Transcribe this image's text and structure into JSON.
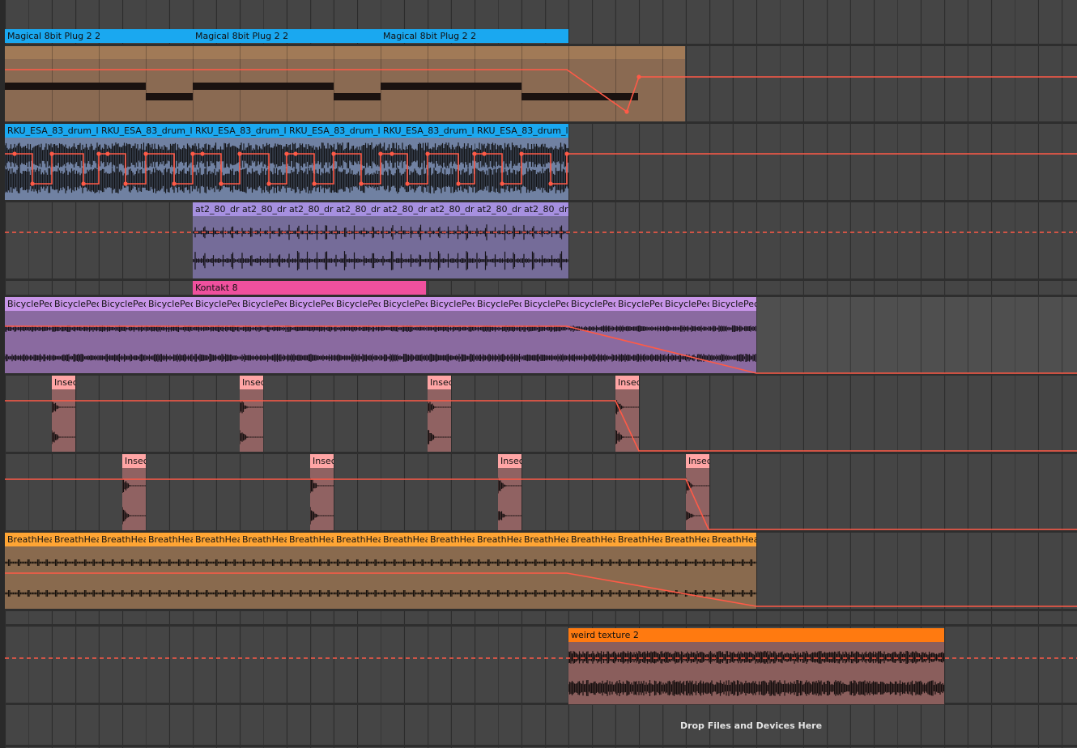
{
  "colors": {
    "background": "#454545",
    "automation": "#ff5a47",
    "clip_blue": "#1aa8f0",
    "clip_tan": "#8a6a52",
    "clip_lavender_header": "#a690e0",
    "clip_lavender_body": "#756c99",
    "clip_pink_header": "#f0509e",
    "clip_violet_header": "#c895e8",
    "clip_violet_body": "#8a6aa0",
    "clip_salmon_header": "#ffa5a5",
    "clip_salmon_body": "#906262",
    "clip_orange_header": "#ffa534",
    "clip_orange_body": "#896a4e",
    "clip_orange2_header": "#ff7a10",
    "clip_orange2_body": "#8a5e5c"
  },
  "tracks": [
    {
      "name": "magical-8bit-track",
      "clips": [
        "Magical 8bit Plug 2 2",
        "Magical 8bit Plug 2 2",
        "Magical 8bit Plug 2 2"
      ]
    },
    {
      "name": "drum-track",
      "clips": [
        "RKU_ESA_83_drum_l",
        "RKU_ESA_83_drum_l",
        "RKU_ESA_83_drum_l",
        "RKU_ESA_83_drum_l",
        "RKU_ESA_83_drum_l",
        "RKU_ESA_83_drum_l"
      ]
    },
    {
      "name": "at2-track",
      "clips": [
        "at2_80_dr",
        "at2_80_dr",
        "at2_80_dr",
        "at2_80_dr",
        "at2_80_dr",
        "at2_80_dr",
        "at2_80_dr",
        "at2_80_dr"
      ]
    },
    {
      "name": "kontakt-track",
      "clips": [
        "Kontakt 8"
      ]
    },
    {
      "name": "bicycle-track",
      "clips": [
        "BicyclePec",
        "BicyclePec",
        "BicyclePec",
        "BicyclePec",
        "BicyclePec",
        "BicyclePec",
        "BicyclePec",
        "BicyclePec",
        "BicyclePec",
        "BicyclePec",
        "BicyclePec",
        "BicyclePec",
        "BicyclePec",
        "BicyclePec",
        "BicyclePec",
        "BicyclePec"
      ]
    },
    {
      "name": "insect-track-a",
      "clips": [
        "Insec",
        "Insec",
        "Insec",
        "Insec"
      ]
    },
    {
      "name": "insect-track-b",
      "clips": [
        "Insec",
        "Insec",
        "Insec",
        "Insec"
      ]
    },
    {
      "name": "breath-track",
      "clips": [
        "BreathHea",
        "BreathHea",
        "BreathHea",
        "BreathHea",
        "BreathHea",
        "BreathHea",
        "BreathHea",
        "BreathHea",
        "BreathHea",
        "BreathHea",
        "BreathHea",
        "BreathHea",
        "BreathHea",
        "BreathHea",
        "BreathHea",
        "BreathHea"
      ]
    },
    {
      "name": "texture-track",
      "clips": [
        "weird texture 2"
      ]
    }
  ],
  "drop_zone": {
    "label": "Drop Files and Devices Here"
  }
}
